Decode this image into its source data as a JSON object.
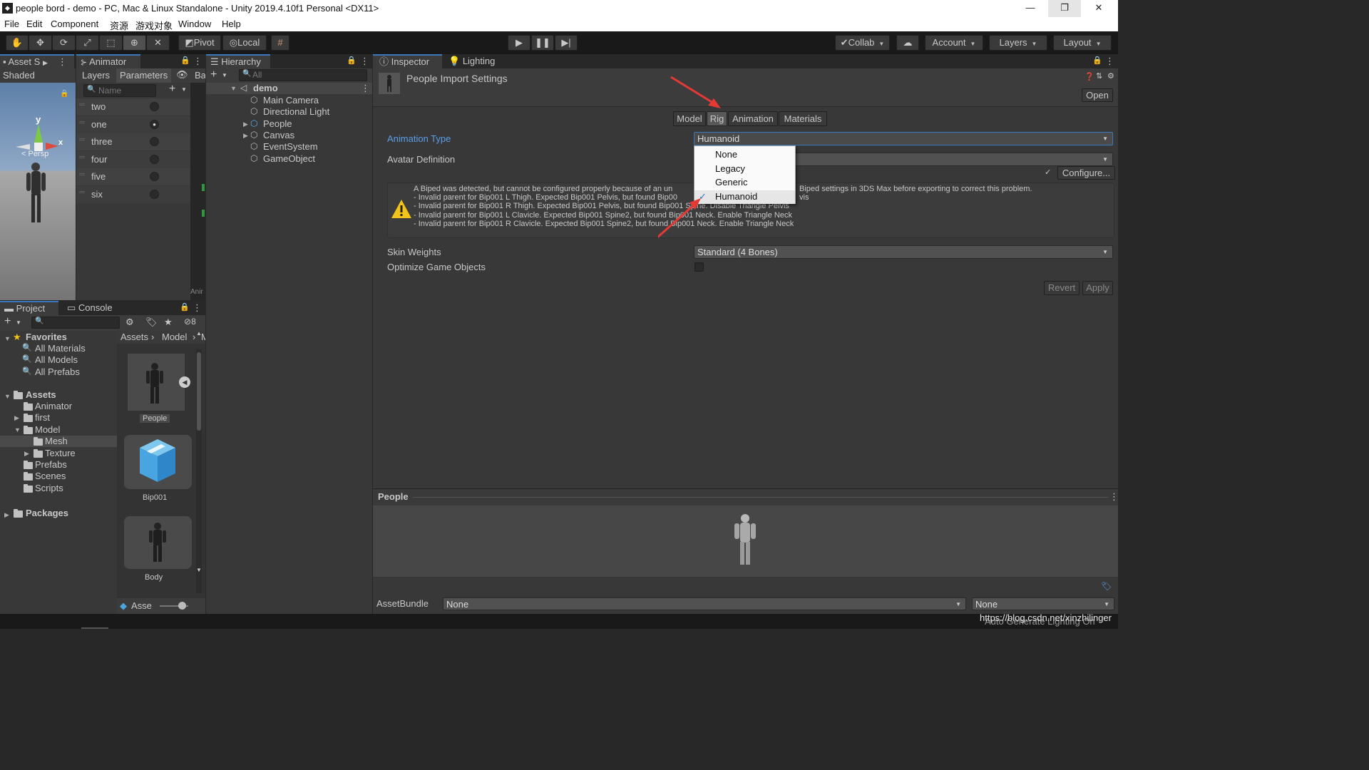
{
  "window": {
    "title": "people bord - demo - PC, Mac & Linux Standalone - Unity 2019.4.10f1 Personal <DX11>",
    "minimize": "—",
    "restore": "❐",
    "close": "✕"
  },
  "menu": [
    "File",
    "Edit",
    "Component",
    "资源",
    "游戏对象",
    "Window",
    "Help"
  ],
  "toolbar": {
    "tools": [
      "hand-tool",
      "move-tool",
      "rotate-tool",
      "scale-tool",
      "rect-tool",
      "transform-tool",
      "custom-tool"
    ],
    "pivot": "Pivot",
    "local": "Local",
    "collab": "Collab",
    "account": "Account",
    "layers": "Layers",
    "layout": "Layout"
  },
  "scene_panel": {
    "tab": "Asset S",
    "mode": "Shaded",
    "gizmo_y": "y",
    "gizmo_x": "x",
    "persp": "< Persp"
  },
  "animator": {
    "tab": "Animator",
    "subtabs": [
      "Layers",
      "Parameters"
    ],
    "cut_tab": "Ba",
    "search_placeholder": "Name",
    "footer": "Anir",
    "parameters": [
      {
        "name": "two",
        "checked": false
      },
      {
        "name": "one",
        "checked": true
      },
      {
        "name": "three",
        "checked": false
      },
      {
        "name": "four",
        "checked": false
      },
      {
        "name": "five",
        "checked": false
      },
      {
        "name": "six",
        "checked": false
      }
    ]
  },
  "hierarchy": {
    "tab": "Hierarchy",
    "search_placeholder": "All",
    "scene": "demo",
    "items": [
      {
        "name": "Main Camera",
        "expandable": false,
        "prefab": false
      },
      {
        "name": "Directional Light",
        "expandable": false,
        "prefab": false
      },
      {
        "name": "People",
        "expandable": true,
        "prefab": true
      },
      {
        "name": "Canvas",
        "expandable": true,
        "prefab": false
      },
      {
        "name": "EventSystem",
        "expandable": false,
        "prefab": false
      },
      {
        "name": "GameObject",
        "expandable": false,
        "prefab": false
      }
    ]
  },
  "project": {
    "tabs": [
      "Project",
      "Console"
    ],
    "hidden_count": "8",
    "favorites_label": "Favorites",
    "favorites": [
      "All Materials",
      "All Models",
      "All Prefabs"
    ],
    "assets_label": "Assets",
    "assets": [
      {
        "name": "Animator",
        "depth": 1,
        "arrow": ""
      },
      {
        "name": "first",
        "depth": 1,
        "arrow": "▶"
      },
      {
        "name": "Model",
        "depth": 1,
        "arrow": "▼"
      },
      {
        "name": "Mesh",
        "depth": 2,
        "arrow": "",
        "selected": true
      },
      {
        "name": "Texture",
        "depth": 2,
        "arrow": "▶"
      },
      {
        "name": "Prefabs",
        "depth": 1,
        "arrow": ""
      },
      {
        "name": "Scenes",
        "depth": 1,
        "arrow": ""
      },
      {
        "name": "Scripts",
        "depth": 1,
        "arrow": ""
      }
    ],
    "packages_label": "Packages",
    "breadcrumb": [
      "Assets",
      "Model",
      "M"
    ],
    "grid_items": [
      "People",
      "Bip001",
      "Body"
    ],
    "footer": "Asse"
  },
  "inspector": {
    "tabs": [
      "Inspector",
      "Lighting"
    ],
    "header_title": "People Import Settings",
    "open_button": "Open",
    "model_tabs": [
      {
        "label": "Model",
        "active": false
      },
      {
        "label": "Rig",
        "active": true
      },
      {
        "label": "Animation",
        "active": false
      },
      {
        "label": "Materials",
        "active": false
      }
    ],
    "animation_type_label": "Animation Type",
    "animation_type_value": "Humanoid",
    "avatar_definition_label": "Avatar Definition",
    "configure_button": "Configure...",
    "warning_lines": [
      "A Biped was detected, but cannot be configured properly because of an un",
      "- Invalid parent for Bip001 L Thigh. Expected Bip001 Pelvis, but found Bip00",
      "- Invalid parent for Bip001 R Thigh. Expected Bip001 Pelvis, but found Bip001 Spine. Disable Triangle Pelvis",
      "- Invalid parent for Bip001 L Clavicle. Expected Bip001 Spine2, but found Bip001 Neck. Enable Triangle Neck",
      "- Invalid parent for Bip001 R Clavicle. Expected Bip001 Spine2, but found Bip001 Neck. Enable Triangle Neck"
    ],
    "warning_tail1": "Biped settings in 3DS Max before exporting to correct this problem.",
    "warning_tail2": "vis",
    "dropdown_options": [
      {
        "label": "None",
        "checked": false
      },
      {
        "label": "Legacy",
        "checked": false
      },
      {
        "label": "Generic",
        "checked": false
      },
      {
        "label": "Humanoid",
        "checked": true
      }
    ],
    "skin_weights_label": "Skin Weights",
    "skin_weights_value": "Standard (4 Bones)",
    "optimize_label": "Optimize Game Objects",
    "revert_button": "Revert",
    "apply_button": "Apply",
    "preview_title": "People",
    "assetbundle_label": "AssetBundle",
    "assetbundle_value": "None",
    "assetbundle_variant": "None"
  },
  "statusbar": {
    "watermark": "https://blog.csdn.net/xinzhilinger",
    "lighting": "Auto Generate Lighting On"
  },
  "colors": {
    "accent": "#3a79bb",
    "link_label": "#5a9ee8",
    "arrow": "#e53935",
    "warning": "#f2c318"
  }
}
